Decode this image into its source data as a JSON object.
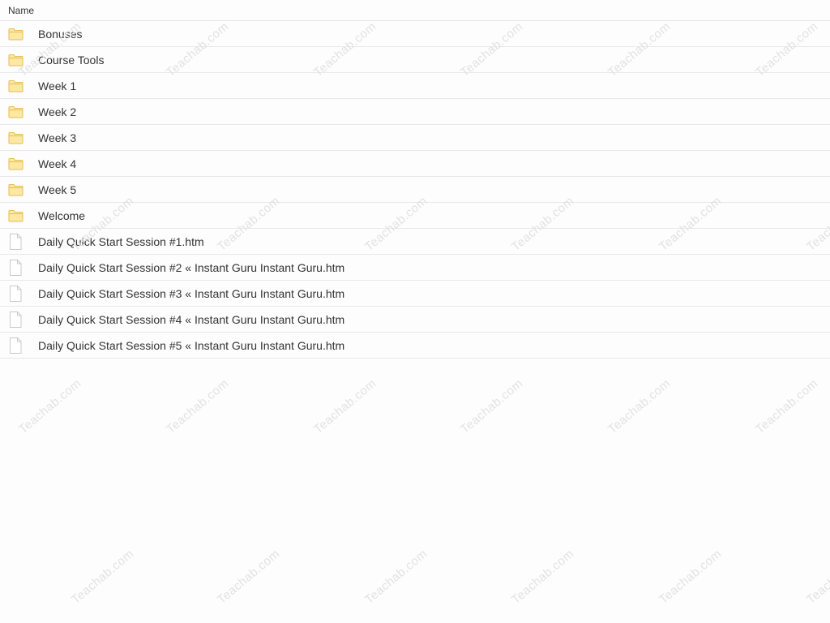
{
  "header": {
    "name_label": "Name"
  },
  "rows": [
    {
      "label": "Bonuses",
      "icon": "folder-icon"
    },
    {
      "label": "Course Tools",
      "icon": "folder-icon"
    },
    {
      "label": "Week 1",
      "icon": "folder-icon"
    },
    {
      "label": "Week 2",
      "icon": "folder-icon"
    },
    {
      "label": "Week 3",
      "icon": "folder-icon"
    },
    {
      "label": "Week 4",
      "icon": "folder-icon"
    },
    {
      "label": "Week 5",
      "icon": "folder-icon"
    },
    {
      "label": "Welcome",
      "icon": "folder-icon"
    },
    {
      "label": "Daily Quick Start Session #1.htm",
      "icon": "file-icon"
    },
    {
      "label": "Daily Quick Start Session #2 « Instant Guru Instant Guru.htm",
      "icon": "file-icon"
    },
    {
      "label": "Daily Quick Start Session #3 « Instant Guru Instant Guru.htm",
      "icon": "file-icon"
    },
    {
      "label": "Daily Quick Start Session #4 « Instant Guru Instant Guru.htm",
      "icon": "file-icon"
    },
    {
      "label": "Daily Quick Start Session #5 « Instant Guru Instant Guru.htm",
      "icon": "file-icon"
    }
  ],
  "watermark": {
    "text": "Teachab.com"
  },
  "colors": {
    "folder_fill": "#fce7a3",
    "folder_stroke": "#e4bf52",
    "file_stroke": "#c9c9c9",
    "watermark": "#e2e2e2"
  }
}
